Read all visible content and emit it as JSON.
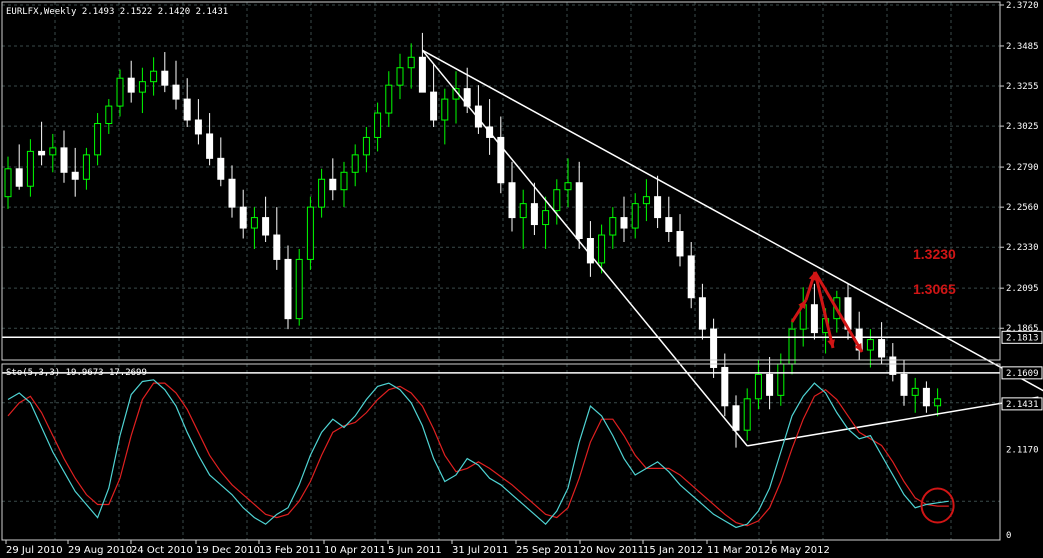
{
  "main_header": "EURLFX,Weekly  2.1493 2.1522 2.1420 2.1431",
  "osc_header": "Sto(5,3,3) 19.9673 17.2699",
  "colors": {
    "background": "#000000",
    "grid": "#3a4a4a",
    "bull": "#00ff00",
    "bear": "#ffffff",
    "trendline": "#ffffff",
    "annotation": "#d01515",
    "stoch_main": "#4fd3d3",
    "stoch_signal": "#e02020"
  },
  "annotations": {
    "level_high": "1.3230",
    "level_low": "1.3065"
  },
  "chart_data": [
    {
      "type": "candlestick",
      "symbol": "EURLFX",
      "timeframe": "Weekly",
      "ylim": [
        2.17,
        2.372
      ],
      "y_ticks": [
        "2.3720",
        "2.3485",
        "2.3255",
        "2.3025",
        "2.2790",
        "2.2560",
        "2.2330",
        "2.2095",
        "2.1865"
      ],
      "price_labels": [
        {
          "text": "2.1813",
          "value": 2.1813
        },
        {
          "text": "2.1609",
          "value": 2.1609
        },
        {
          "text": "2.1431",
          "value": 2.1431
        },
        {
          "text": "2.1170",
          "value": 2.117
        }
      ],
      "x_labels": [
        "29 Jul 2010",
        "29 Aug 2010",
        "24 Oct 2010",
        "19 Dec 2010",
        "13 Feb 2011",
        "10 Apr 2011",
        "5 Jun 2011",
        "31 Jul 2011",
        "25 Sep 2011",
        "20 Nov 2011",
        "15 Jan 2012",
        "11 Mar 2012",
        "6 May 2012"
      ],
      "ohlc": [
        [
          2.262,
          2.285,
          2.255,
          2.278
        ],
        [
          2.278,
          2.292,
          2.266,
          2.268
        ],
        [
          2.268,
          2.295,
          2.262,
          2.288
        ],
        [
          2.288,
          2.305,
          2.28,
          2.286
        ],
        [
          2.286,
          2.298,
          2.276,
          2.29
        ],
        [
          2.29,
          2.3,
          2.27,
          2.276
        ],
        [
          2.276,
          2.29,
          2.262,
          2.272
        ],
        [
          2.272,
          2.29,
          2.266,
          2.286
        ],
        [
          2.286,
          2.31,
          2.28,
          2.304
        ],
        [
          2.304,
          2.318,
          2.298,
          2.314
        ],
        [
          2.314,
          2.335,
          2.308,
          2.33
        ],
        [
          2.33,
          2.34,
          2.316,
          2.322
        ],
        [
          2.322,
          2.336,
          2.31,
          2.328
        ],
        [
          2.328,
          2.342,
          2.32,
          2.334
        ],
        [
          2.334,
          2.345,
          2.322,
          2.326
        ],
        [
          2.326,
          2.34,
          2.312,
          2.318
        ],
        [
          2.318,
          2.33,
          2.302,
          2.306
        ],
        [
          2.306,
          2.318,
          2.292,
          2.298
        ],
        [
          2.298,
          2.31,
          2.28,
          2.284
        ],
        [
          2.284,
          2.296,
          2.268,
          2.272
        ],
        [
          2.272,
          2.28,
          2.25,
          2.256
        ],
        [
          2.256,
          2.266,
          2.238,
          2.244
        ],
        [
          2.244,
          2.256,
          2.232,
          2.25
        ],
        [
          2.25,
          2.262,
          2.236,
          2.24
        ],
        [
          2.24,
          2.256,
          2.22,
          2.226
        ],
        [
          2.226,
          2.234,
          2.186,
          2.192
        ],
        [
          2.192,
          2.232,
          2.188,
          2.226
        ],
        [
          2.226,
          2.262,
          2.22,
          2.256
        ],
        [
          2.256,
          2.278,
          2.25,
          2.272
        ],
        [
          2.272,
          2.284,
          2.26,
          2.266
        ],
        [
          2.266,
          2.282,
          2.256,
          2.276
        ],
        [
          2.276,
          2.292,
          2.268,
          2.286
        ],
        [
          2.286,
          2.302,
          2.276,
          2.296
        ],
        [
          2.296,
          2.316,
          2.288,
          2.31
        ],
        [
          2.31,
          2.334,
          2.302,
          2.326
        ],
        [
          2.326,
          2.344,
          2.318,
          2.336
        ],
        [
          2.336,
          2.35,
          2.324,
          2.342
        ],
        [
          2.342,
          2.356,
          2.33,
          2.322
        ],
        [
          2.322,
          2.338,
          2.302,
          2.306
        ],
        [
          2.306,
          2.324,
          2.292,
          2.318
        ],
        [
          2.318,
          2.334,
          2.304,
          2.324
        ],
        [
          2.324,
          2.336,
          2.31,
          2.314
        ],
        [
          2.314,
          2.326,
          2.298,
          2.302
        ],
        [
          2.302,
          2.318,
          2.286,
          2.296
        ],
        [
          2.296,
          2.308,
          2.264,
          2.27
        ],
        [
          2.27,
          2.282,
          2.242,
          2.25
        ],
        [
          2.25,
          2.266,
          2.232,
          2.258
        ],
        [
          2.258,
          2.27,
          2.24,
          2.246
        ],
        [
          2.246,
          2.262,
          2.232,
          2.254
        ],
        [
          2.254,
          2.272,
          2.246,
          2.266
        ],
        [
          2.266,
          2.284,
          2.256,
          2.27
        ],
        [
          2.27,
          2.282,
          2.232,
          2.238
        ],
        [
          2.238,
          2.248,
          2.216,
          2.224
        ],
        [
          2.224,
          2.246,
          2.218,
          2.24
        ],
        [
          2.24,
          2.256,
          2.232,
          2.25
        ],
        [
          2.25,
          2.262,
          2.236,
          2.244
        ],
        [
          2.244,
          2.264,
          2.238,
          2.258
        ],
        [
          2.258,
          2.272,
          2.248,
          2.262
        ],
        [
          2.262,
          2.274,
          2.244,
          2.25
        ],
        [
          2.25,
          2.262,
          2.236,
          2.242
        ],
        [
          2.242,
          2.252,
          2.222,
          2.228
        ],
        [
          2.228,
          2.236,
          2.198,
          2.204
        ],
        [
          2.204,
          2.212,
          2.18,
          2.186
        ],
        [
          2.186,
          2.192,
          2.158,
          2.164
        ],
        [
          2.164,
          2.172,
          2.136,
          2.142
        ],
        [
          2.142,
          2.148,
          2.118,
          2.128
        ],
        [
          2.128,
          2.152,
          2.122,
          2.146
        ],
        [
          2.146,
          2.168,
          2.14,
          2.16
        ],
        [
          2.16,
          2.17,
          2.14,
          2.148
        ],
        [
          2.148,
          2.172,
          2.142,
          2.166
        ],
        [
          2.166,
          2.192,
          2.16,
          2.186
        ],
        [
          2.186,
          2.21,
          2.176,
          2.2
        ],
        [
          2.2,
          2.212,
          2.18,
          2.184
        ],
        [
          2.184,
          2.198,
          2.172,
          2.192
        ],
        [
          2.192,
          2.208,
          2.184,
          2.204
        ],
        [
          2.204,
          2.212,
          2.18,
          2.186
        ],
        [
          2.186,
          2.196,
          2.168,
          2.174
        ],
        [
          2.174,
          2.186,
          2.164,
          2.18
        ],
        [
          2.18,
          2.19,
          2.166,
          2.17
        ],
        [
          2.17,
          2.178,
          2.156,
          2.16
        ],
        [
          2.16,
          2.168,
          2.142,
          2.148
        ],
        [
          2.148,
          2.158,
          2.138,
          2.152
        ],
        [
          2.152,
          2.156,
          2.138,
          2.142
        ],
        [
          2.142,
          2.152,
          2.136,
          2.146
        ]
      ],
      "trendlines": [
        {
          "from": [
            37,
            2.346
          ],
          "to": [
            66,
            2.119
          ]
        },
        {
          "from": [
            37,
            2.346
          ],
          "to": [
            102,
            2.117
          ]
        },
        {
          "from": [
            66,
            2.119
          ],
          "to": [
            92,
            2.147
          ]
        }
      ],
      "horizontal_lines": [
        2.1813,
        2.1609
      ]
    },
    {
      "type": "line",
      "name": "Sto(5,3,3)",
      "ylim": [
        0,
        100
      ],
      "y_ticks": [
        "100",
        "0"
      ],
      "series": [
        {
          "name": "main",
          "values": [
            82,
            86,
            80,
            65,
            50,
            38,
            26,
            18,
            10,
            28,
            60,
            85,
            93,
            94,
            88,
            78,
            62,
            48,
            36,
            30,
            24,
            16,
            10,
            6,
            12,
            16,
            30,
            48,
            62,
            70,
            65,
            72,
            82,
            90,
            92,
            88,
            80,
            66,
            46,
            32,
            36,
            46,
            42,
            34,
            30,
            24,
            18,
            12,
            6,
            14,
            28,
            56,
            78,
            72,
            60,
            46,
            36,
            40,
            44,
            38,
            30,
            24,
            18,
            12,
            8,
            4,
            6,
            14,
            28,
            50,
            72,
            84,
            92,
            86,
            74,
            64,
            58,
            60,
            48,
            36,
            24,
            16,
            18,
            19,
            20
          ]
        },
        {
          "name": "signal",
          "values": [
            72,
            80,
            84,
            74,
            60,
            46,
            34,
            24,
            18,
            18,
            34,
            60,
            82,
            92,
            92,
            86,
            76,
            62,
            48,
            38,
            30,
            24,
            18,
            12,
            10,
            12,
            20,
            32,
            48,
            62,
            66,
            68,
            74,
            82,
            88,
            90,
            86,
            78,
            64,
            48,
            38,
            40,
            44,
            40,
            35,
            30,
            24,
            18,
            12,
            10,
            16,
            34,
            56,
            70,
            70,
            60,
            48,
            40,
            40,
            40,
            36,
            30,
            24,
            18,
            12,
            7,
            5,
            8,
            16,
            32,
            52,
            70,
            84,
            88,
            82,
            72,
            62,
            58,
            54,
            44,
            32,
            22,
            18,
            17,
            17
          ]
        }
      ]
    }
  ]
}
